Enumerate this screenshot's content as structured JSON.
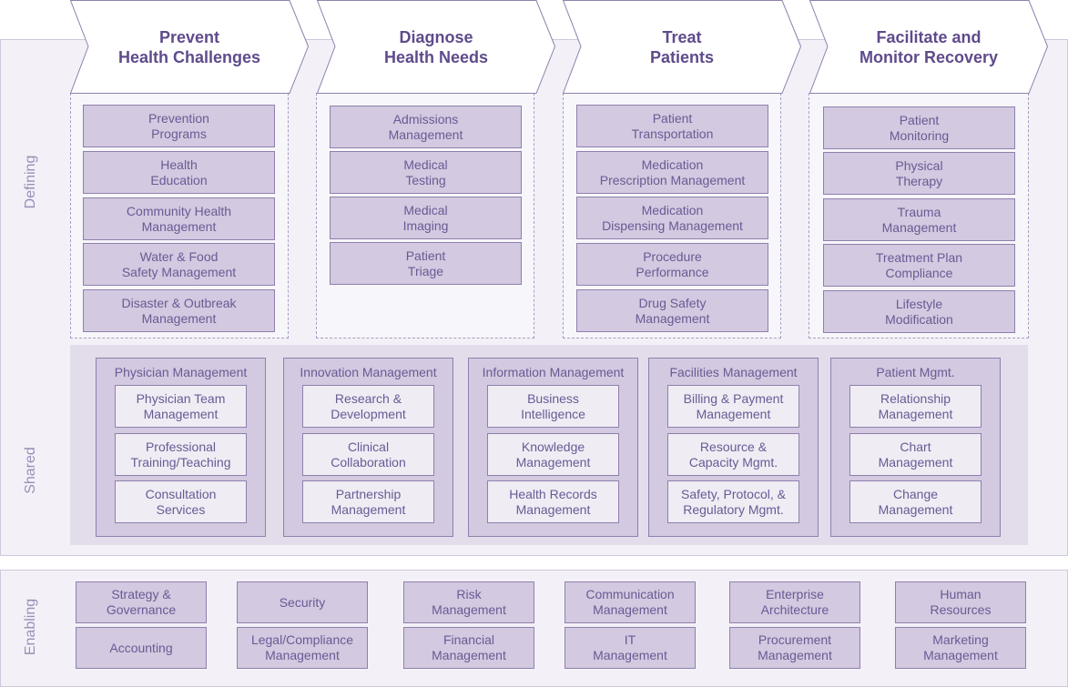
{
  "layers": {
    "defining": "Defining",
    "shared": "Shared",
    "enabling": "Enabling"
  },
  "stages": [
    {
      "title": "Prevent\nHealth Challenges",
      "items": [
        "Prevention\nPrograms",
        "Health\nEducation",
        "Community Health\nManagement",
        "Water & Food\nSafety Management",
        "Disaster & Outbreak\nManagement"
      ]
    },
    {
      "title": "Diagnose\nHealth Needs",
      "items": [
        "Admissions\nManagement",
        "Medical\nTesting",
        "Medical\nImaging",
        "Patient\nTriage"
      ]
    },
    {
      "title": "Treat\nPatients",
      "items": [
        "Patient\nTransportation",
        "Medication\nPrescription Management",
        "Medication\nDispensing Management",
        "Procedure\nPerformance",
        "Drug Safety\nManagement"
      ]
    },
    {
      "title": "Facilitate and\nMonitor Recovery",
      "items": [
        "Patient\nMonitoring",
        "Physical\nTherapy",
        "Trauma\nManagement",
        "Treatment Plan\nCompliance",
        "Lifestyle\nModification"
      ]
    }
  ],
  "shared_groups": [
    {
      "title": "Physician Management",
      "items": [
        "Physician Team\nManagement",
        "Professional\nTraining/Teaching",
        "Consultation\nServices"
      ]
    },
    {
      "title": "Innovation  Management",
      "items": [
        "Research &\nDevelopment",
        "Clinical\nCollaboration",
        "Partnership\nManagement"
      ]
    },
    {
      "title": "Information Management",
      "items": [
        "Business\nIntelligence",
        "Knowledge\nManagement",
        "Health Records\nManagement"
      ]
    },
    {
      "title": "Facilities Management",
      "items": [
        "Billing & Payment\nManagement",
        "Resource &\nCapacity Mgmt.",
        "Safety, Protocol, &\nRegulatory Mgmt."
      ]
    },
    {
      "title": "Patient Mgmt.",
      "items": [
        "Relationship\nManagement",
        "Chart\nManagement",
        "Change\nManagement"
      ]
    }
  ],
  "enabling": [
    [
      "Strategy &\nGovernance",
      "Accounting"
    ],
    [
      "Security",
      "Legal/Compliance\nManagement"
    ],
    [
      "Risk\nManagement",
      "Financial\nManagement"
    ],
    [
      "Communication\nManagement",
      "IT\nManagement"
    ],
    [
      "Enterprise\nArchitecture",
      "Procurement\nManagement"
    ],
    [
      "Human\nResources",
      "Marketing\nManagement"
    ]
  ],
  "colors": {
    "accent": "#5f4b8b",
    "box_fill": "#d3c9e0",
    "box_border": "#8f80ad",
    "band": "#e3ddeb",
    "panel": "#f3f1f7"
  }
}
